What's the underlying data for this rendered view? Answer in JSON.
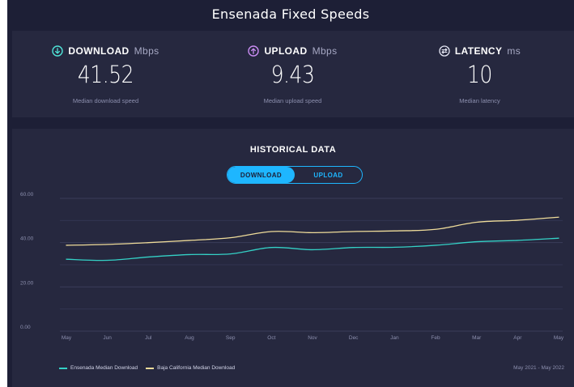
{
  "page": {
    "title": "Ensenada Fixed Speeds"
  },
  "stats": [
    {
      "icon": "download-arrow-icon",
      "label": "DOWNLOAD",
      "unit": "Mbps",
      "value": "41.52",
      "caption": "Median download speed",
      "color": "#4fe3d7"
    },
    {
      "icon": "upload-arrow-icon",
      "label": "UPLOAD",
      "unit": "Mbps",
      "value": "9.43",
      "caption": "Median upload speed",
      "color": "#c98cf2"
    },
    {
      "icon": "latency-icon",
      "label": "LATENCY",
      "unit": "ms",
      "value": "10",
      "caption": "Median latency",
      "color": "#e6e8f5"
    }
  ],
  "history": {
    "title": "HISTORICAL DATA",
    "tabs": [
      {
        "label": "DOWNLOAD",
        "active": true
      },
      {
        "label": "UPLOAD",
        "active": false
      }
    ],
    "date_range": "May 2021 - May 2022"
  },
  "chart_data": {
    "type": "line",
    "title": "",
    "xlabel": "",
    "ylabel": "",
    "x": [
      "May",
      "Jun",
      "Jul",
      "Aug",
      "Sep",
      "Oct",
      "Nov",
      "Dec",
      "Jan",
      "Feb",
      "Mar",
      "Apr",
      "May"
    ],
    "yticks": [
      "60.00",
      "40.00",
      "20.00",
      "0.00"
    ],
    "ylim": [
      0,
      60
    ],
    "grid": true,
    "legend_position": "bottom-left",
    "series": [
      {
        "name": "Ensenada Median Download",
        "color": "#34d1c6",
        "values": [
          32.5,
          32.0,
          33.5,
          34.6,
          34.9,
          37.8,
          36.8,
          37.8,
          37.9,
          38.8,
          40.4,
          41.0,
          42.0
        ]
      },
      {
        "name": "Baja California Median Download",
        "color": "#efdc9a",
        "values": [
          38.8,
          39.2,
          40.0,
          41.0,
          42.2,
          45.0,
          44.5,
          45.0,
          45.3,
          46.0,
          49.2,
          50.1,
          51.5
        ]
      }
    ]
  }
}
